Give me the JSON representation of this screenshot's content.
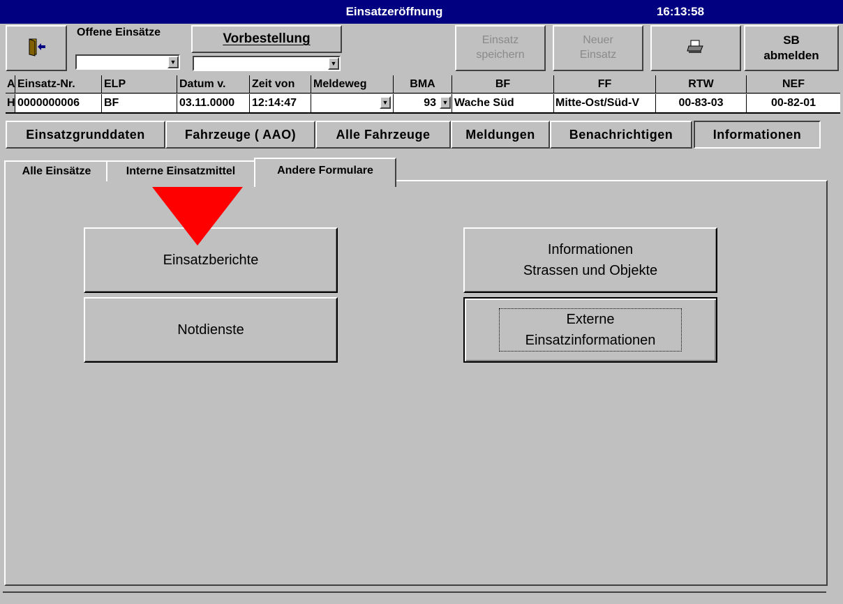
{
  "window": {
    "title": "Einsatzeröffnung",
    "clock": "16:13:58"
  },
  "toolbar": {
    "offene_label": "Offene Einsätze",
    "vorbestellung_label": "Vorbestellung",
    "speichern_label": "Einsatz speichern",
    "neuer_label": "Neuer Einsatz",
    "abmelden_label": "SB abmelden"
  },
  "grid": {
    "headers": [
      "A",
      "Einsatz-Nr.",
      "ELP",
      "Datum v.",
      "Zeit von",
      "Meldeweg",
      "BMA",
      "BF",
      "FF",
      "RTW",
      "NEF"
    ],
    "row": [
      "H",
      "0000000006",
      "BF",
      "03.11.0000",
      "12:14:47",
      "",
      "93",
      "Wache Süd",
      "Mitte-Ost/Süd-V",
      "00-83-03",
      "00-82-01"
    ]
  },
  "nav": [
    "Einsatzgrunddaten",
    "Fahrzeuge ( AAO)",
    "Alle Fahrzeuge",
    "Meldungen",
    "Benachrichtigen",
    "Informationen"
  ],
  "tabs": [
    "Alle Einsätze",
    "Interne Einsatzmittel",
    "Andere Formulare"
  ],
  "buttons": {
    "einsatzberichte": "Einsatzberichte",
    "notdienste": "Notdienste",
    "info_line1": "Informationen",
    "info_line2": "Strassen und Objekte",
    "ext_line1": "Externe",
    "ext_line2": "Einsatzinformationen"
  },
  "colors": {
    "titlebar": "#000080",
    "face": "#c0c0c0",
    "marker": "#ff0000"
  }
}
